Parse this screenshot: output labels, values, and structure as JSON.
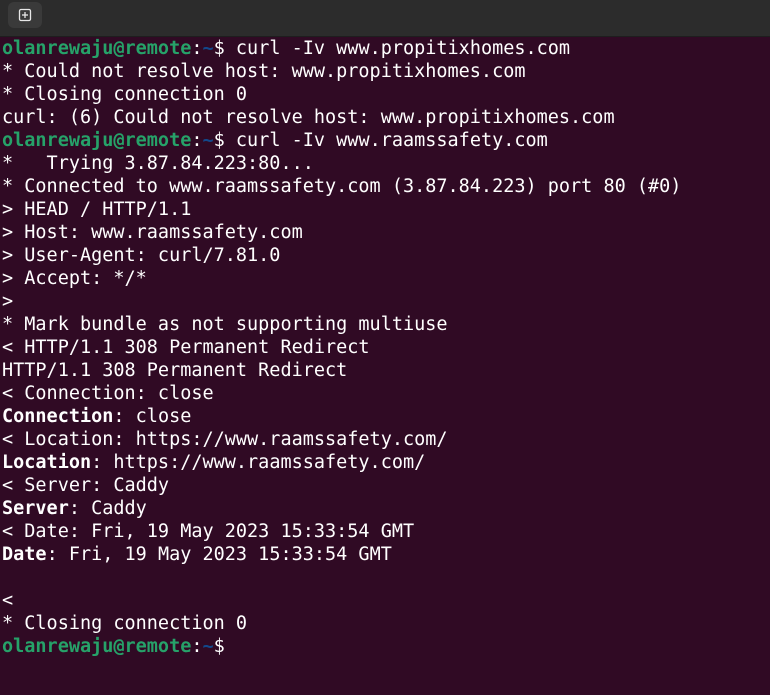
{
  "colors": {
    "background": "#300a24",
    "prompt_user": "#26a269",
    "prompt_path": "#12488b",
    "text": "#ffffff",
    "titlebar": "#2c2c2c"
  },
  "titlebar": {
    "new_tab_icon": "new-tab-plus-icon"
  },
  "prompt": {
    "user_host": "olanrewaju@remote",
    "colon": ":",
    "path": "~",
    "sign": "$ "
  },
  "lines": [
    {
      "type": "prompt",
      "command": "curl -Iv www.propitixhomes.com"
    },
    {
      "type": "text",
      "text": "* Could not resolve host: www.propitixhomes.com"
    },
    {
      "type": "text",
      "text": "* Closing connection 0"
    },
    {
      "type": "text",
      "text": "curl: (6) Could not resolve host: www.propitixhomes.com"
    },
    {
      "type": "prompt",
      "command": "curl -Iv www.raamssafety.com"
    },
    {
      "type": "text",
      "text": "*   Trying 3.87.84.223:80..."
    },
    {
      "type": "text",
      "text": "* Connected to www.raamssafety.com (3.87.84.223) port 80 (#0)"
    },
    {
      "type": "text",
      "text": "> HEAD / HTTP/1.1"
    },
    {
      "type": "text",
      "text": "> Host: www.raamssafety.com"
    },
    {
      "type": "text",
      "text": "> User-Agent: curl/7.81.0"
    },
    {
      "type": "text",
      "text": "> Accept: */*"
    },
    {
      "type": "text",
      "text": ">"
    },
    {
      "type": "text",
      "text": "* Mark bundle as not supporting multiuse"
    },
    {
      "type": "text",
      "text": "< HTTP/1.1 308 Permanent Redirect"
    },
    {
      "type": "text",
      "text": "HTTP/1.1 308 Permanent Redirect"
    },
    {
      "type": "text",
      "text": "< Connection: close"
    },
    {
      "type": "header",
      "key": "Connection",
      "value": ": close"
    },
    {
      "type": "text",
      "text": "< Location: https://www.raamssafety.com/"
    },
    {
      "type": "header",
      "key": "Location",
      "value": ": https://www.raamssafety.com/"
    },
    {
      "type": "text",
      "text": "< Server: Caddy"
    },
    {
      "type": "header",
      "key": "Server",
      "value": ": Caddy"
    },
    {
      "type": "text",
      "text": "< Date: Fri, 19 May 2023 15:33:54 GMT"
    },
    {
      "type": "header",
      "key": "Date",
      "value": ": Fri, 19 May 2023 15:33:54 GMT"
    },
    {
      "type": "text",
      "text": ""
    },
    {
      "type": "text",
      "text": "<"
    },
    {
      "type": "text",
      "text": "* Closing connection 0"
    },
    {
      "type": "prompt",
      "command": ""
    }
  ]
}
